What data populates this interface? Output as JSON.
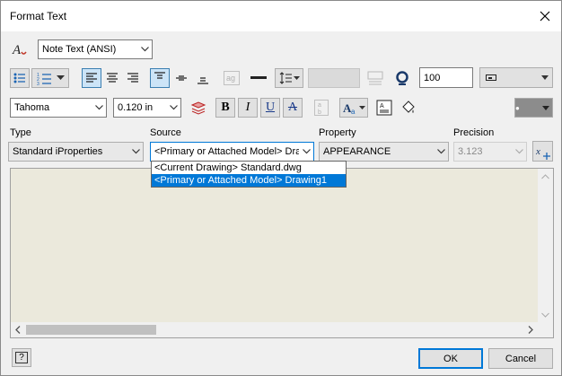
{
  "window": {
    "title": "Format Text"
  },
  "style": {
    "selected": "Note Text (ANSI)"
  },
  "row2": {
    "spacing_value": "100"
  },
  "font": {
    "name": "Tahoma",
    "size": "0.120 in"
  },
  "type": {
    "label": "Type",
    "value": "Standard iProperties"
  },
  "source": {
    "label": "Source",
    "value": "<Primary or Attached Model> Dra",
    "options": [
      "<Current Drawing> Standard.dwg",
      "<Primary or Attached Model> Drawing1"
    ],
    "selected_index": 1
  },
  "property": {
    "label": "Property",
    "value": "APPEARANCE"
  },
  "precision": {
    "label": "Precision",
    "value": "3.123"
  },
  "buttons": {
    "ok": "OK",
    "cancel": "Cancel",
    "help": "?"
  },
  "colors": {
    "accent": "#0078d7",
    "text_area_bg": "#ebe9dc",
    "pressed_bg": "#cce4f7"
  },
  "icons": {
    "style": "text-style-icon",
    "bullets": "bulleted-list-icon",
    "numbering": "numbered-list-icon",
    "align_left": "align-left-icon",
    "align_center": "align-center-icon",
    "align_right": "align-right-icon",
    "valign_top": "valign-top-icon",
    "valign_middle": "valign-middle-icon",
    "valign_bottom": "valign-bottom-icon",
    "stack": "stack-text-icon",
    "line": "horizontal-line-icon",
    "line_spacing": "line-spacing-icon",
    "symbol": "symbol-icon",
    "wrap": "wrap-icon",
    "bold": "bold-icon",
    "italic": "italic-icon",
    "underline": "underline-icon",
    "strike": "strikethrough-icon",
    "insert_param": "insert-parameter-icon"
  }
}
